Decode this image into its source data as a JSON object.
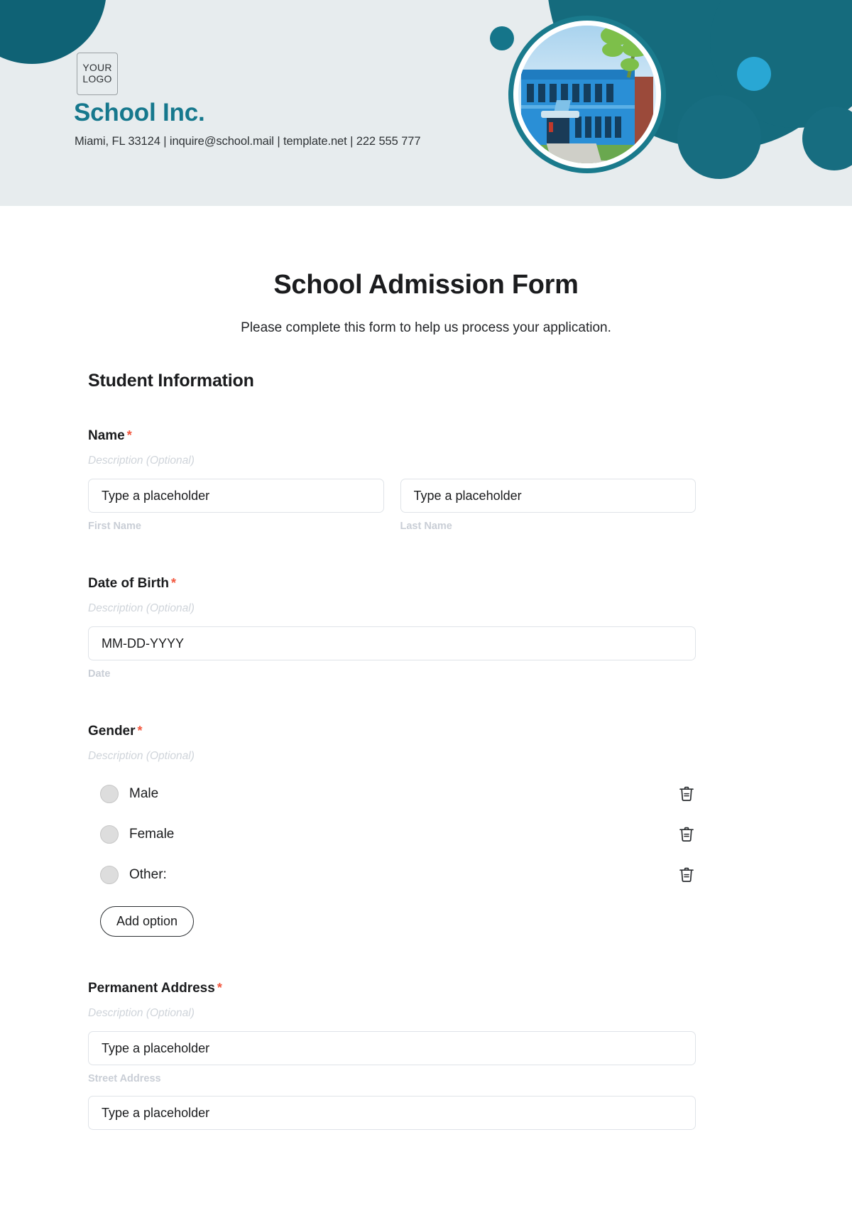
{
  "header": {
    "logo_line1": "YOUR",
    "logo_line2": "LOGO",
    "brand_name": "School Inc.",
    "contact_line": "Miami, FL 33124 | inquire@school.mail | template.net | 222 555 777",
    "brand_color": "#16788d",
    "background_color": "#e7ecee",
    "accent_color": "#156b7d",
    "accent_light_color": "#29a7d4",
    "photo_alt": "school-building-photo"
  },
  "form": {
    "title": "School Admission Form",
    "subtitle": "Please complete this form to help us process your application.",
    "section_title": "Student Information",
    "required_marker": "*",
    "description_placeholder": "Description (Optional)",
    "required_star_color": "#f2563d",
    "fields": [
      {
        "label": "Name",
        "required": true,
        "description": "Description (Optional)",
        "inputs": [
          {
            "placeholder": "Type a placeholder",
            "value": "Type a placeholder",
            "sub_label": "First Name"
          },
          {
            "placeholder": "Type a placeholder",
            "value": "Type a placeholder",
            "sub_label": "Last Name"
          }
        ]
      },
      {
        "label": "Date of Birth",
        "required": true,
        "description": "Description (Optional)",
        "inputs": [
          {
            "placeholder": "MM-DD-YYYY",
            "value": "MM-DD-YYYY",
            "sub_label": "Date"
          }
        ]
      },
      {
        "label": "Gender",
        "required": true,
        "description": "Description (Optional)",
        "options": [
          {
            "label": "Male",
            "selected": false,
            "delete_icon": "trash-icon"
          },
          {
            "label": "Female",
            "selected": false,
            "delete_icon": "trash-icon"
          },
          {
            "label": "Other:",
            "selected": false,
            "delete_icon": "trash-icon"
          }
        ],
        "add_option_label": "Add option"
      },
      {
        "label": "Permanent Address",
        "required": true,
        "description": "Description (Optional)",
        "inputs": [
          {
            "placeholder": "Type a placeholder",
            "value": "Type a placeholder",
            "sub_label": "Street Address"
          },
          {
            "placeholder": "Type a placeholder",
            "value": "Type a placeholder",
            "sub_label": ""
          }
        ]
      }
    ]
  }
}
